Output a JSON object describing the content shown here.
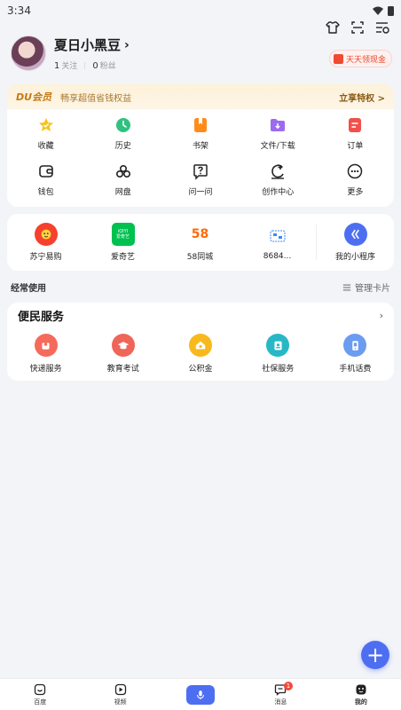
{
  "status_bar": {
    "time": "3:34"
  },
  "profile": {
    "name": "夏日小黑豆",
    "following_count": "1",
    "following_label": "关注",
    "fans_count": "0",
    "fans_label": "粉丝"
  },
  "cash_pill": {
    "label": "天天领现金"
  },
  "membership": {
    "title": "DU会员",
    "subtitle": "畅享超值省钱权益",
    "link": "立享特权 >"
  },
  "grid": {
    "items": [
      {
        "label": "收藏",
        "icon": "star-icon",
        "color": "#f7c31a"
      },
      {
        "label": "历史",
        "icon": "clock-icon",
        "color": "#2fc27f"
      },
      {
        "label": "书架",
        "icon": "bookshelf-icon",
        "color": "#ff8c1a"
      },
      {
        "label": "文件/下载",
        "icon": "folder-download-icon",
        "color": "#9b6bf0"
      },
      {
        "label": "订单",
        "icon": "order-icon",
        "color": "#f2504b"
      },
      {
        "label": "钱包",
        "icon": "wallet-icon",
        "color": "#222222"
      },
      {
        "label": "网盘",
        "icon": "cloud-drive-icon",
        "color": "#222222"
      },
      {
        "label": "问一问",
        "icon": "question-icon",
        "color": "#222222"
      },
      {
        "label": "创作中心",
        "icon": "create-icon",
        "color": "#222222"
      },
      {
        "label": "更多",
        "icon": "more-icon",
        "color": "#222222"
      }
    ]
  },
  "mini_programs": {
    "items": [
      {
        "label": "苏宁易购",
        "icon": "suning-icon",
        "color": "#f5412d"
      },
      {
        "label": "爱奇艺",
        "icon": "iqiyi-icon",
        "color": "#00c050",
        "logo_text": "iQIYI\n爱奇艺"
      },
      {
        "label": "58同城",
        "icon": "58-icon",
        "color": "#ff6a00",
        "logo_text": "58"
      },
      {
        "label": "8684...",
        "icon": "8684-icon",
        "color": "#3b8bf0"
      },
      {
        "label": "我的小程序",
        "icon": "my-mini-program-icon",
        "color": "#4e6ef2"
      }
    ]
  },
  "section": {
    "title": "经常使用",
    "manage_label": "管理卡片"
  },
  "services": {
    "title": "便民服务",
    "more": "›",
    "items": [
      {
        "label": "快递服务",
        "icon": "express-icon",
        "color": "#f56a5b"
      },
      {
        "label": "教育考试",
        "icon": "education-icon",
        "color": "#f0655a"
      },
      {
        "label": "公积金",
        "icon": "housing-fund-icon",
        "color": "#f7b91d"
      },
      {
        "label": "社保服务",
        "icon": "social-security-icon",
        "color": "#27b8c6"
      },
      {
        "label": "手机话费",
        "icon": "phone-bill-icon",
        "color": "#6b9cf0"
      }
    ]
  },
  "fab": {
    "label": "+"
  },
  "bottom_nav": {
    "items": [
      {
        "label": "百度",
        "icon": "baidu-home-icon"
      },
      {
        "label": "视频",
        "icon": "video-icon"
      },
      {
        "label": "",
        "icon": "voice-icon"
      },
      {
        "label": "消息",
        "icon": "message-icon",
        "badge": "1"
      },
      {
        "label": "我的",
        "icon": "mine-icon"
      }
    ]
  }
}
